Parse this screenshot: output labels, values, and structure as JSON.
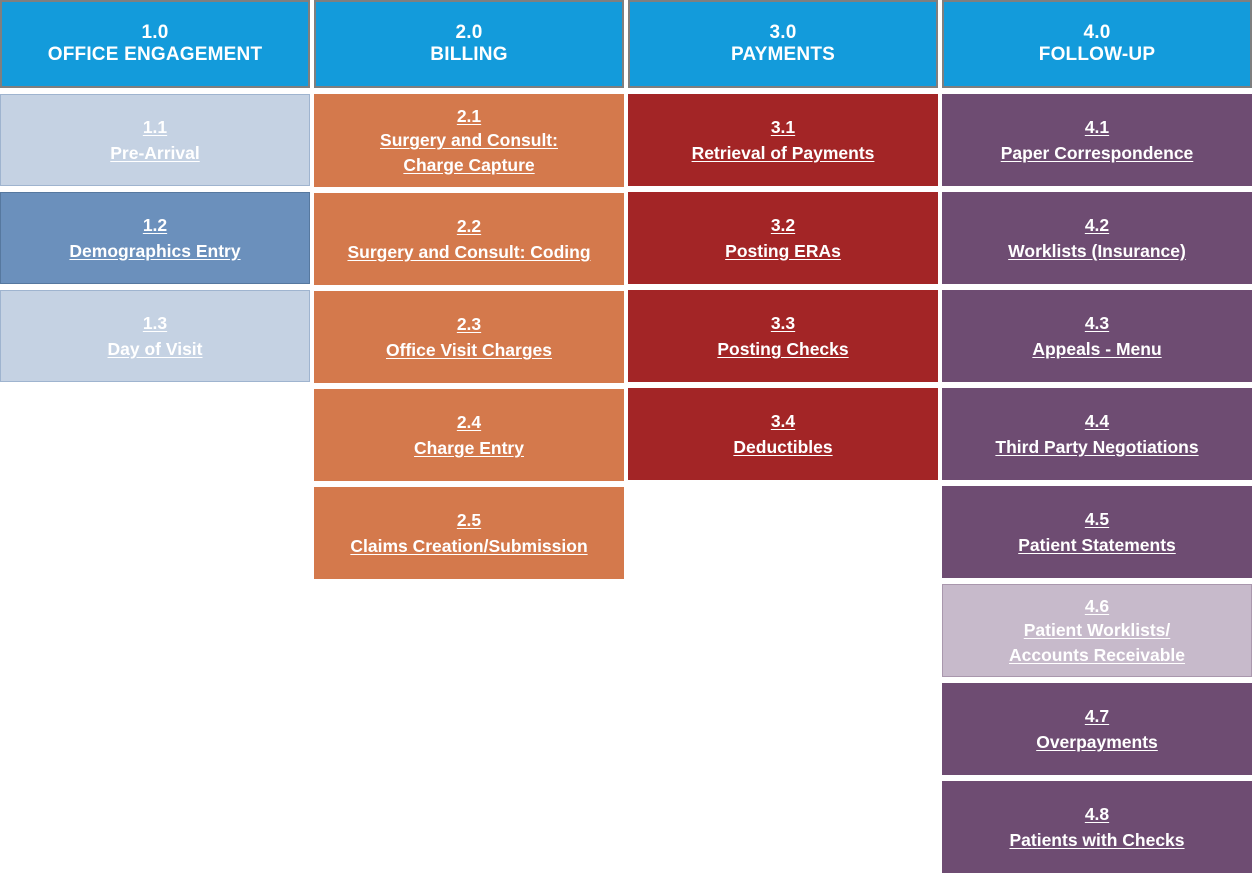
{
  "colors": {
    "header_blue": "#139BDB",
    "header_border_gray": "#7F7F7F",
    "light_blue": "#C5D2E3",
    "steel_blue": "#6B90BC",
    "orange": "#D4794C",
    "red": "#A32526",
    "purple": "#6E4C72",
    "light_purple": "#C7BACB",
    "text_white": "#FFFFFF",
    "background": "#FFFFFF"
  },
  "columns": [
    {
      "header": {
        "number": "1.0",
        "name": "OFFICE ENGAGEMENT"
      },
      "cards": [
        {
          "number": "1.1",
          "line1": "Pre-Arrival",
          "line2": "",
          "tone": "lightblue"
        },
        {
          "number": "1.2",
          "line1": "Demographics Entry",
          "line2": "",
          "tone": "steelblue"
        },
        {
          "number": "1.3",
          "line1": "Day of Visit",
          "line2": "",
          "tone": "lightblue"
        }
      ]
    },
    {
      "header": {
        "number": "2.0",
        "name": "BILLING"
      },
      "cards": [
        {
          "number": "2.1",
          "line1": "Surgery and Consult:",
          "line2": "Charge Capture",
          "tone": "orange"
        },
        {
          "number": "2.2",
          "line1": "Surgery and Consult: Coding",
          "line2": "",
          "tone": "orange"
        },
        {
          "number": "2.3",
          "line1": "Office Visit Charges",
          "line2": "",
          "tone": "orange"
        },
        {
          "number": "2.4",
          "line1": "Charge Entry",
          "line2": "",
          "tone": "orange"
        },
        {
          "number": "2.5",
          "line1": "Claims Creation/Submission",
          "line2": "",
          "tone": "orange"
        }
      ]
    },
    {
      "header": {
        "number": "3.0",
        "name": "PAYMENTS"
      },
      "cards": [
        {
          "number": "3.1",
          "line1": "Retrieval of Payments",
          "line2": "",
          "tone": "red"
        },
        {
          "number": "3.2",
          "line1": "Posting ERAs",
          "line2": "",
          "tone": "red"
        },
        {
          "number": "3.3",
          "line1": "Posting Checks",
          "line2": "",
          "tone": "red"
        },
        {
          "number": "3.4",
          "line1": "Deductibles",
          "line2": "",
          "tone": "red"
        }
      ]
    },
    {
      "header": {
        "number": "4.0",
        "name": "FOLLOW-UP"
      },
      "cards": [
        {
          "number": "4.1",
          "line1": "Paper Correspondence",
          "line2": "",
          "tone": "purple"
        },
        {
          "number": "4.2",
          "line1": "Worklists (Insurance)",
          "line2": "",
          "tone": "purple"
        },
        {
          "number": "4.3",
          "line1": "Appeals - Menu",
          "line2": "",
          "tone": "purple"
        },
        {
          "number": "4.4",
          "line1": "Third Party Negotiations",
          "line2": "",
          "tone": "purple"
        },
        {
          "number": "4.5",
          "line1": "Patient Statements",
          "line2": "",
          "tone": "purple"
        },
        {
          "number": "4.6",
          "line1": "Patient Worklists/",
          "line2": "Accounts Receivable",
          "tone": "lightpurple"
        },
        {
          "number": "4.7",
          "line1": "Overpayments",
          "line2": "",
          "tone": "purple"
        },
        {
          "number": "4.8",
          "line1": "Patients with Checks",
          "line2": "",
          "tone": "purple"
        }
      ]
    }
  ]
}
